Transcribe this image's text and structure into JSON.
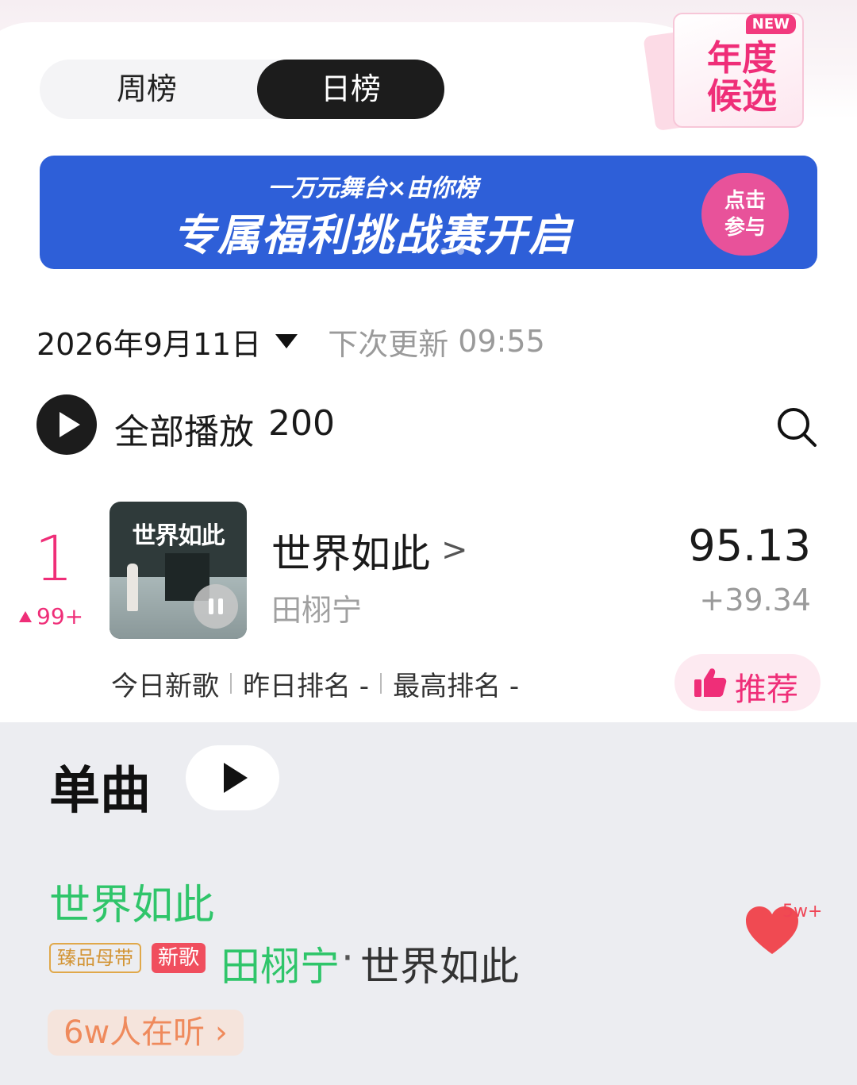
{
  "tabs": {
    "week": "周榜",
    "day": "日榜"
  },
  "award": {
    "new_badge": "NEW",
    "line1": "年度",
    "line2": "候选"
  },
  "banner": {
    "subtitle": "一万元舞台×由你榜",
    "title": "专属福利挑战赛开启",
    "button_line1": "点击",
    "button_line2": "参与"
  },
  "date_row": {
    "date": "2026年9月11日",
    "next_update_label": "下次更新",
    "next_update_time": "09:55"
  },
  "play_all": {
    "label": "全部播放",
    "count": "200"
  },
  "entry": {
    "rank": "1",
    "rank_change": "99+",
    "cover_text": "世界如此",
    "title": "世界如此",
    "artist": "田栩宁",
    "score": "95.13",
    "score_delta": "+39.34",
    "meta_new": "今日新歌",
    "meta_yesterday": "昨日排名 -",
    "meta_best": "最高排名 -",
    "recommend": "推荐"
  },
  "single_section": {
    "title": "单曲",
    "song_title": "世界如此",
    "badge_quality": "臻品母带",
    "badge_new": "新歌",
    "artist": "田栩宁",
    "separator": "·",
    "album": "世界如此",
    "listening": "6w人在听",
    "listening_chevron": "›",
    "likes": "5w+"
  },
  "colors": {
    "accent_pink": "#ef2e78",
    "green": "#2fc56a",
    "banner_blue": "#2e5fd8"
  }
}
